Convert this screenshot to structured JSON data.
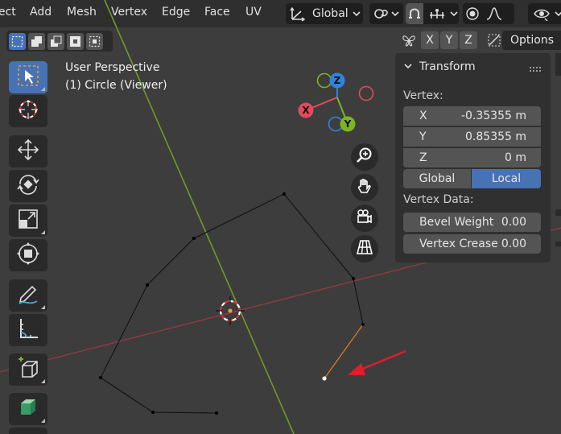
{
  "menu": {
    "items": [
      "ect",
      "Add",
      "Mesh",
      "Vertex",
      "Edge",
      "Face",
      "UV"
    ]
  },
  "header": {
    "orientation_value": "Global",
    "icons": [
      "transform-orientation-icon",
      "pivot-icon",
      "snap-magnet-icon",
      "snap-increment-icon",
      "proportional-editing-icon",
      "falloff-curve-icon",
      "view-object-types-icon"
    ]
  },
  "select_modes": [
    "select-new",
    "select-extend",
    "select-subtract",
    "select-difference",
    "select-intersect"
  ],
  "axis_buttons": {
    "x": "X",
    "y": "Y",
    "z": "Z"
  },
  "options_label": "Options",
  "viewport": {
    "title": "User Perspective",
    "subtitle": "(1) Circle (Viewer)"
  },
  "gizmo": {
    "z_label": "Z",
    "x_label": "X",
    "y_label": "Y"
  },
  "tools": [
    "select-box",
    "cursor",
    "move",
    "rotate",
    "scale",
    "transform",
    "annotate",
    "measure",
    "add-cube",
    "extrude"
  ],
  "panel": {
    "title": "Transform",
    "vertex_label": "Vertex:",
    "fields": [
      {
        "label": "X",
        "value": "-0.35355 m"
      },
      {
        "label": "Y",
        "value": "0.85355 m"
      },
      {
        "label": "Z",
        "value": "0 m"
      }
    ],
    "toggle_global": "Global",
    "toggle_local": "Local",
    "vertex_data_label": "Vertex Data:",
    "bevel_weight": {
      "label": "Bevel Weight",
      "value": "0.00"
    },
    "vertex_crease": {
      "label": "Vertex Crease",
      "value": "0.00"
    }
  },
  "colors": {
    "accent": "#4772b3",
    "axis_x": "#e04a5c",
    "axis_y": "#7db521",
    "axis_z": "#2f84e0",
    "annotation_arrow": "#e01e28",
    "selected_edge": "#e87a1e"
  }
}
